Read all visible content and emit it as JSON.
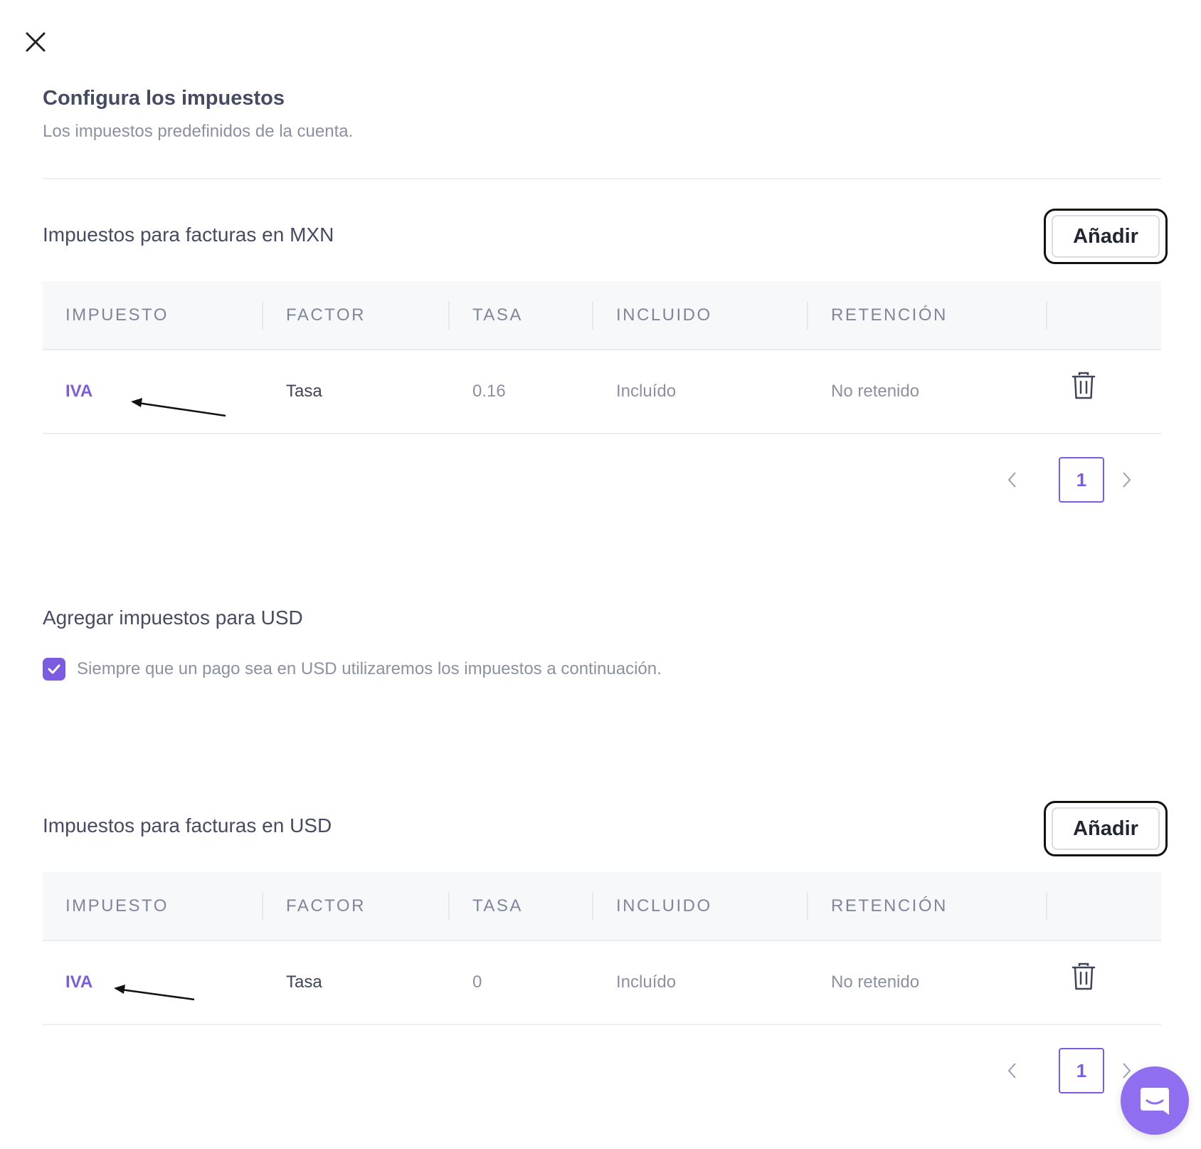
{
  "header": {
    "title": "Configura los impuestos",
    "subtitle": "Los impuestos predefinidos de la cuenta."
  },
  "mxn": {
    "title": "Impuestos para facturas en MXN",
    "add_label": "Añadir",
    "columns": [
      "IMPUESTO",
      "FACTOR",
      "TASA",
      "INCLUIDO",
      "RETENCIÓN"
    ],
    "rows": [
      {
        "impuesto": "IVA",
        "factor": "Tasa",
        "tasa": "0.16",
        "incluido": "Incluído",
        "retencion": "No retenido"
      }
    ],
    "page": "1"
  },
  "usd_toggle": {
    "title": "Agregar impuestos para USD",
    "checkbox_label": "Siempre que un pago sea en USD utilizaremos los impuestos a continuación.",
    "checked": true
  },
  "usd": {
    "title": "Impuestos para facturas en USD",
    "add_label": "Añadir",
    "columns": [
      "IMPUESTO",
      "FACTOR",
      "TASA",
      "INCLUIDO",
      "RETENCIÓN"
    ],
    "rows": [
      {
        "impuesto": "IVA",
        "factor": "Tasa",
        "tasa": "0",
        "incluido": "Incluído",
        "retencion": "No retenido"
      }
    ],
    "page": "1"
  },
  "colors": {
    "accent": "#7b5ce0",
    "chat_button": "#8f6ff0"
  },
  "icons": [
    "close-icon",
    "trash-icon",
    "chevron-left-icon",
    "chevron-right-icon",
    "check-icon",
    "chat-icon",
    "arrow-annotation"
  ]
}
